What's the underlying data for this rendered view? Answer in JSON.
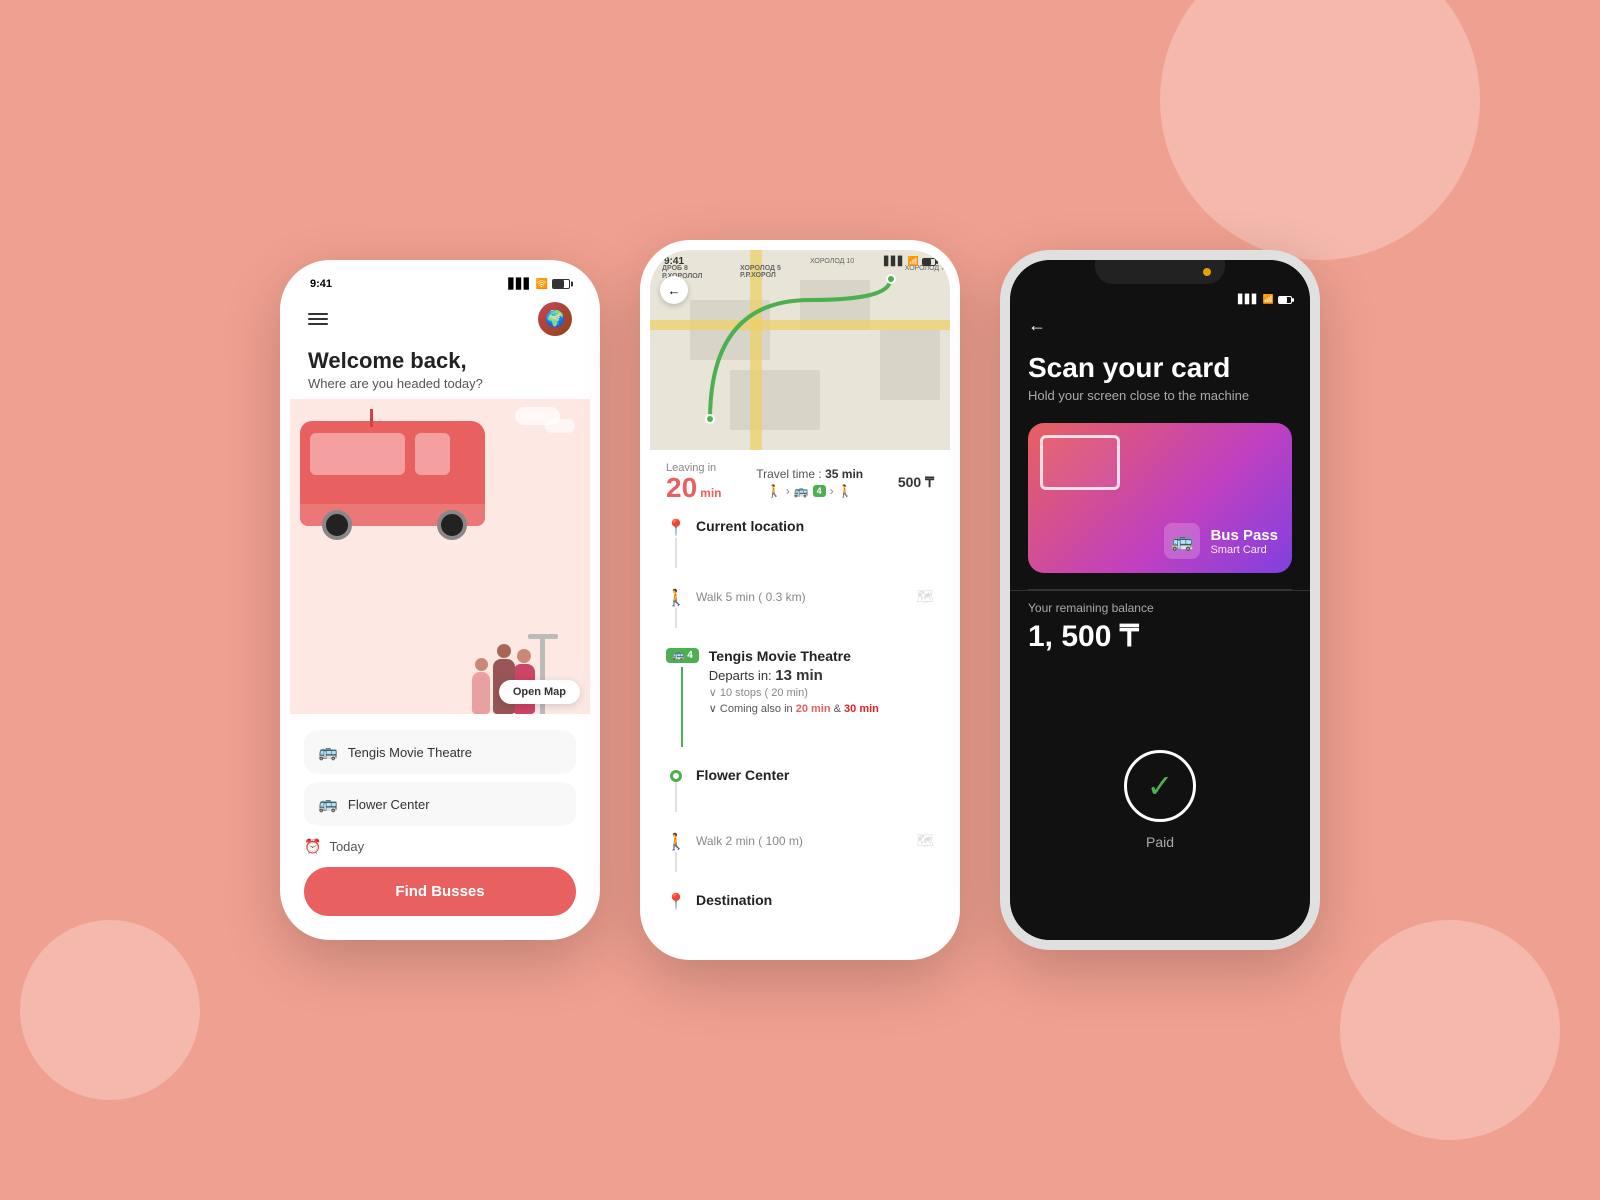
{
  "background": {
    "color": "#f0a090"
  },
  "phone1": {
    "status_time": "9:41",
    "header": {
      "menu_label": "menu",
      "avatar_label": "user avatar"
    },
    "welcome": {
      "title": "Welcome back,",
      "subtitle": "Where are you headed today?"
    },
    "map_button": "Open Map",
    "destinations": [
      {
        "label": "Tengis Movie Theatre",
        "icon": "bus"
      },
      {
        "label": "Flower Center",
        "icon": "bus"
      }
    ],
    "date_label": "Today",
    "find_button": "Find Busses"
  },
  "phone2": {
    "status_time": "9:41",
    "leaving_label": "Leaving in",
    "leaving_value": "20",
    "leaving_unit": "min",
    "travel_label": "Travel time :",
    "travel_value": "35 min",
    "price": "500 ₸",
    "steps": [
      {
        "type": "location",
        "title": "Current location",
        "sub": ""
      },
      {
        "type": "walk",
        "title": "Walk 5 min ( 0.3 km)",
        "sub": ""
      },
      {
        "type": "bus",
        "title": "Tengis Movie Theatre",
        "departs": "Departs in: 13 min",
        "stops": "10 stops ( 20 min)",
        "coming": "Coming also in",
        "coming_times": [
          "20 min",
          "30 min"
        ]
      },
      {
        "type": "walk2",
        "title": "Walk 2 min ( 100 m)",
        "sub": ""
      },
      {
        "type": "destination",
        "title": "Flower Center",
        "sub": ""
      },
      {
        "type": "dest-pin",
        "title": "Destination",
        "sub": ""
      }
    ]
  },
  "phone3": {
    "title": "Scan your card",
    "subtitle": "Hold your screen close to the machine",
    "card": {
      "title": "Bus Pass",
      "subtitle": "Smart Card"
    },
    "balance_label": "Your remaining balance",
    "balance_value": "1, 500 ₸",
    "paid_label": "Paid"
  }
}
